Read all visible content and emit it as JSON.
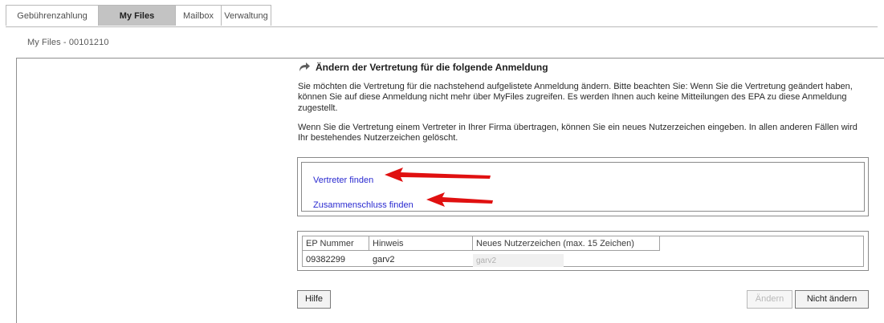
{
  "tabs": [
    {
      "label": "Gebührenzahlung",
      "active": false
    },
    {
      "label": "My Files",
      "active": true
    },
    {
      "label": "Mailbox",
      "active": false
    },
    {
      "label": "Verwaltung",
      "active": false
    }
  ],
  "breadcrumb": "My Files - 00101210",
  "heading": "Ändern der Vertretung für die folgende Anmeldung",
  "paragraph_1": "Sie möchten die Vertretung für die nachstehend aufgelistete Anmeldung ändern. Bitte beachten Sie: Wenn Sie die Vertretung geändert haben, können Sie auf diese Anmeldung nicht mehr über MyFiles zugreifen. Es werden Ihnen auch keine Mitteilungen des EPA zu diese Anmeldung zugestellt.",
  "paragraph_2": "Wenn Sie die Vertretung einem Vertreter in Ihrer Firma übertragen, können Sie ein neues Nutzerzeichen eingeben. In allen anderen Fällen wird Ihr bestehendes Nutzerzeichen gelöscht.",
  "links": {
    "vertreter": "Vertreter finden",
    "zusammenschluss": "Zusammenschluss finden"
  },
  "table": {
    "headers": [
      "EP Nummer",
      "Hinweis",
      "Neues Nutzerzeichen (max. 15 Zeichen)"
    ],
    "row": {
      "ep_nummer": "09382299",
      "hinweis": "garv2",
      "nutzerzeichen_value": "garv2"
    }
  },
  "buttons": {
    "hilfe": "Hilfe",
    "aendern": "Ändern",
    "nicht_aendern": "Nicht ändern"
  },
  "colors": {
    "link": "#2a2ad0",
    "annotation_arrow": "#e01010",
    "active_tab": "#c3c3c3"
  }
}
